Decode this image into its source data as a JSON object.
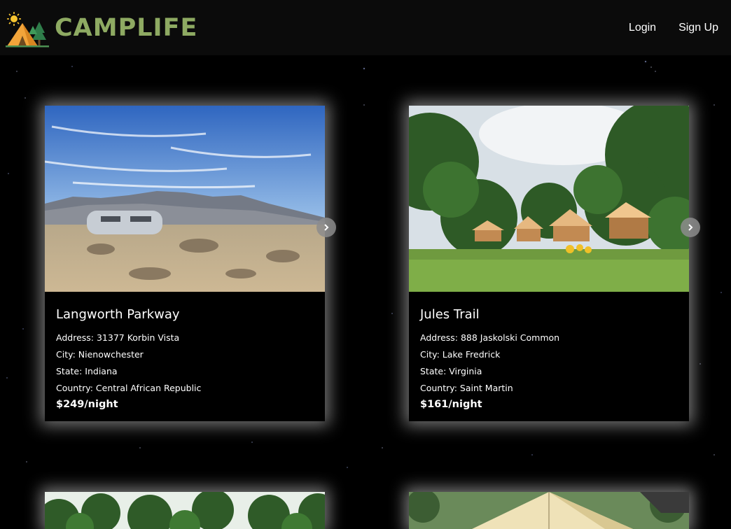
{
  "header": {
    "brand": "CAMPLIFE",
    "nav": {
      "login": "Login",
      "signup": "Sign Up"
    }
  },
  "listings": [
    {
      "title": "Langworth Parkway",
      "address": "Address: 31377 Korbin Vista",
      "city": "City: Nienowchester",
      "state": "State: Indiana",
      "country": "Country: Central African Republic",
      "price": "$249/night"
    },
    {
      "title": "Jules Trail",
      "address": "Address: 888 Jaskolski Common",
      "city": "City: Lake Fredrick",
      "state": "State: Virginia",
      "country": "Country: Saint Martin",
      "price": "$161/night"
    }
  ],
  "colors": {
    "brand": "#8eaa62",
    "background": "#000000",
    "header": "#0b0b0b"
  },
  "icons": [
    "sun-icon",
    "tent-icon",
    "tree-icon",
    "chevron-right-icon"
  ]
}
